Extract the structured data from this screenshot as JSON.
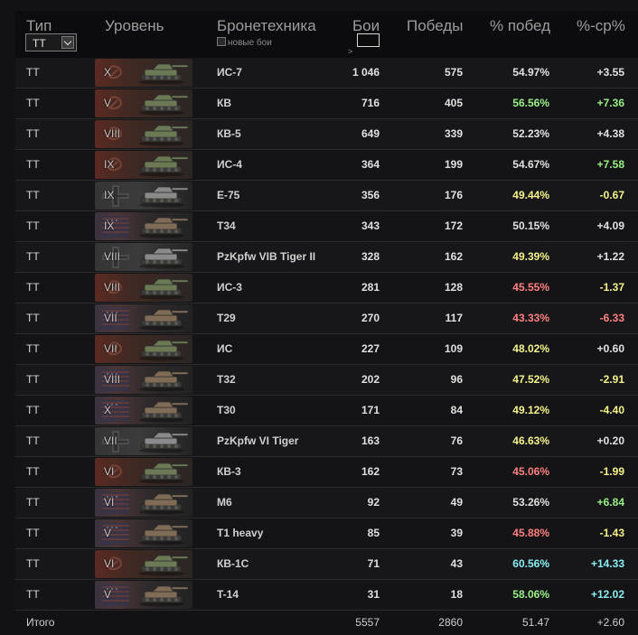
{
  "header": {
    "type": "Тип",
    "level": "Уровень",
    "vehicle": "Бронетехника",
    "battles": "Бои",
    "wins": "Победы",
    "win_pct": "% побед",
    "diff": "%-ср%",
    "type_select": "ТТ",
    "new_battles": "новые бои",
    "gt": ">"
  },
  "colors": {
    "pink": "#ff8080",
    "yellow": "#f4f28a",
    "white": "#e1e1e1",
    "green": "#98f085",
    "cyan": "#88eef2"
  },
  "rows": [
    {
      "type": "ТТ",
      "level": "X",
      "nation": "ussr",
      "name": "ИС-7",
      "battles": "1 046",
      "wins": "575",
      "pct": "54.97%",
      "pct_color": "white",
      "diff": "+3.55",
      "diff_color": "white"
    },
    {
      "type": "ТТ",
      "level": "V",
      "nation": "ussr",
      "name": "КВ",
      "battles": "716",
      "wins": "405",
      "pct": "56.56%",
      "pct_color": "green",
      "diff": "+7.36",
      "diff_color": "green"
    },
    {
      "type": "ТТ",
      "level": "VIII",
      "nation": "ussr",
      "name": "КВ-5",
      "battles": "649",
      "wins": "339",
      "pct": "52.23%",
      "pct_color": "white",
      "diff": "+4.38",
      "diff_color": "white"
    },
    {
      "type": "ТТ",
      "level": "IX",
      "nation": "ussr",
      "name": "ИС-4",
      "battles": "364",
      "wins": "199",
      "pct": "54.67%",
      "pct_color": "white",
      "diff": "+7.58",
      "diff_color": "green"
    },
    {
      "type": "ТТ",
      "level": "IX",
      "nation": "germany",
      "name": "E-75",
      "battles": "356",
      "wins": "176",
      "pct": "49.44%",
      "pct_color": "yellow",
      "diff": "-0.67",
      "diff_color": "yellow"
    },
    {
      "type": "ТТ",
      "level": "IX",
      "nation": "usa",
      "name": "T34",
      "battles": "343",
      "wins": "172",
      "pct": "50.15%",
      "pct_color": "white",
      "diff": "+4.09",
      "diff_color": "white"
    },
    {
      "type": "ТТ",
      "level": "VIII",
      "nation": "germany",
      "name": "PzKpfw VIB Tiger II",
      "battles": "328",
      "wins": "162",
      "pct": "49.39%",
      "pct_color": "yellow",
      "diff": "+1.22",
      "diff_color": "white"
    },
    {
      "type": "ТТ",
      "level": "VIII",
      "nation": "ussr",
      "name": "ИС-3",
      "battles": "281",
      "wins": "128",
      "pct": "45.55%",
      "pct_color": "pink",
      "diff": "-1.37",
      "diff_color": "yellow"
    },
    {
      "type": "ТТ",
      "level": "VII",
      "nation": "usa",
      "name": "T29",
      "battles": "270",
      "wins": "117",
      "pct": "43.33%",
      "pct_color": "pink",
      "diff": "-6.33",
      "diff_color": "pink"
    },
    {
      "type": "ТТ",
      "level": "VII",
      "nation": "ussr",
      "name": "ИС",
      "battles": "227",
      "wins": "109",
      "pct": "48.02%",
      "pct_color": "yellow",
      "diff": "+0.60",
      "diff_color": "white"
    },
    {
      "type": "ТТ",
      "level": "VIII",
      "nation": "usa",
      "name": "T32",
      "battles": "202",
      "wins": "96",
      "pct": "47.52%",
      "pct_color": "yellow",
      "diff": "-2.91",
      "diff_color": "yellow"
    },
    {
      "type": "ТТ",
      "level": "X",
      "nation": "usa",
      "name": "T30",
      "battles": "171",
      "wins": "84",
      "pct": "49.12%",
      "pct_color": "yellow",
      "diff": "-4.40",
      "diff_color": "yellow"
    },
    {
      "type": "ТТ",
      "level": "VII",
      "nation": "germany",
      "name": "PzKpfw VI Tiger",
      "battles": "163",
      "wins": "76",
      "pct": "46.63%",
      "pct_color": "yellow",
      "diff": "+0.20",
      "diff_color": "white"
    },
    {
      "type": "ТТ",
      "level": "VI",
      "nation": "ussr",
      "name": "КВ-3",
      "battles": "162",
      "wins": "73",
      "pct": "45.06%",
      "pct_color": "pink",
      "diff": "-1.99",
      "diff_color": "yellow"
    },
    {
      "type": "ТТ",
      "level": "VI",
      "nation": "usa",
      "name": "M6",
      "battles": "92",
      "wins": "49",
      "pct": "53.26%",
      "pct_color": "white",
      "diff": "+6.84",
      "diff_color": "green"
    },
    {
      "type": "ТТ",
      "level": "V",
      "nation": "usa",
      "name": "T1 heavy",
      "battles": "85",
      "wins": "39",
      "pct": "45.88%",
      "pct_color": "pink",
      "diff": "-1.43",
      "diff_color": "yellow"
    },
    {
      "type": "ТТ",
      "level": "VI",
      "nation": "ussr",
      "name": "КВ-1С",
      "battles": "71",
      "wins": "43",
      "pct": "60.56%",
      "pct_color": "cyan",
      "diff": "+14.33",
      "diff_color": "cyan"
    },
    {
      "type": "ТТ",
      "level": "V",
      "nation": "usa",
      "name": "T-14",
      "battles": "31",
      "wins": "18",
      "pct": "58.06%",
      "pct_color": "green",
      "diff": "+12.02",
      "diff_color": "cyan"
    }
  ],
  "total": {
    "label": "Итого",
    "battles": "5557",
    "wins": "2860",
    "pct": "51.47",
    "diff": "+2.60"
  }
}
